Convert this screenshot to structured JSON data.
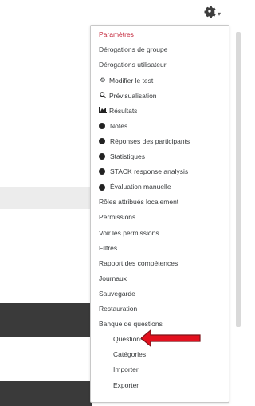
{
  "header": {
    "settings_icon": "gear-icon",
    "caret": "▾"
  },
  "menu": {
    "items": [
      {
        "label": "Paramètres",
        "icon": "",
        "indent": 0,
        "active": true
      },
      {
        "label": "Dérogations de groupe",
        "icon": "",
        "indent": 0
      },
      {
        "label": "Dérogations utilisateur",
        "icon": "",
        "indent": 0
      },
      {
        "label": "Modifier le test",
        "icon": "cog-icon",
        "indent": 0
      },
      {
        "label": "Prévisualisation",
        "icon": "search-icon",
        "indent": 0
      },
      {
        "label": "Résultats",
        "icon": "chart-icon",
        "indent": 0
      },
      {
        "label": "Notes",
        "icon": "bullet",
        "indent": 1
      },
      {
        "label": "Réponses des participants",
        "icon": "bullet",
        "indent": 1
      },
      {
        "label": "Statistiques",
        "icon": "bullet",
        "indent": 1
      },
      {
        "label": "STACK response analysis",
        "icon": "bullet",
        "indent": 1
      },
      {
        "label": "Évaluation manuelle",
        "icon": "bullet",
        "indent": 1
      },
      {
        "label": "Rôles attribués localement",
        "icon": "",
        "indent": 0
      },
      {
        "label": "Permissions",
        "icon": "",
        "indent": 0
      },
      {
        "label": "Voir les permissions",
        "icon": "",
        "indent": 0
      },
      {
        "label": "Filtres",
        "icon": "",
        "indent": 0
      },
      {
        "label": "Rapport des compétences",
        "icon": "",
        "indent": 0
      },
      {
        "label": "Journaux",
        "icon": "",
        "indent": 0
      },
      {
        "label": "Sauvegarde",
        "icon": "",
        "indent": 0
      },
      {
        "label": "Restauration",
        "icon": "",
        "indent": 0
      },
      {
        "label": "Banque de questions",
        "icon": "",
        "indent": 0
      },
      {
        "label": "Questions",
        "icon": "",
        "indent": 2
      },
      {
        "label": "Catégories",
        "icon": "",
        "indent": 2,
        "highlighted": true
      },
      {
        "label": "Importer",
        "icon": "",
        "indent": 2
      },
      {
        "label": "Exporter",
        "icon": "",
        "indent": 2
      }
    ]
  },
  "colors": {
    "active": "#c22035",
    "annotation_arrow": "#e3101e",
    "text": "#373a3c"
  }
}
